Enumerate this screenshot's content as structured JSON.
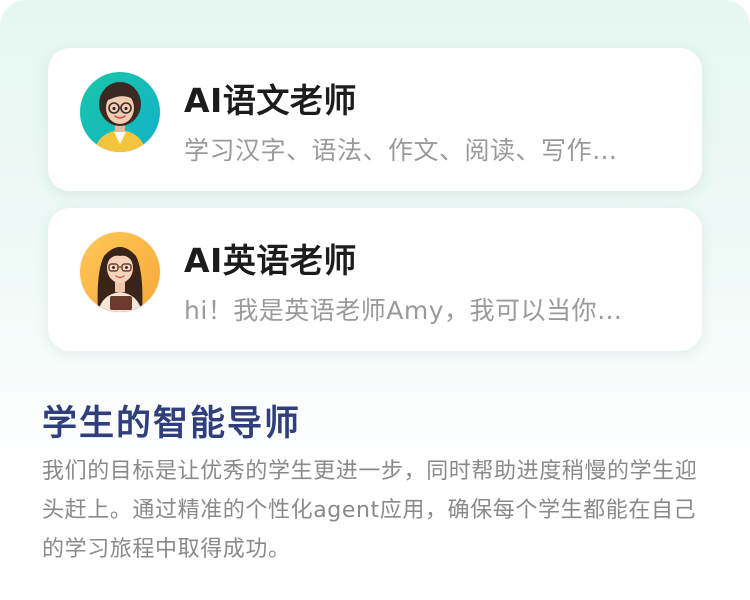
{
  "teachers": [
    {
      "title": "AI语文老师",
      "description": "学习汉字、语法、作文、阅读、写作…",
      "avatar_icon": "teacher-avatar-chinese"
    },
    {
      "title": "AI英语老师",
      "description": "hi！我是英语老师Amy，我可以当你…",
      "avatar_icon": "teacher-avatar-english"
    }
  ],
  "section": {
    "title": "学生的智能导师",
    "body": "我们的目标是让优秀的学生更进一步，同时帮助进度稍慢的学生迎头赶上。通过精准的个性化agent应用，确保每个学生都能在自己的学习旅程中取得成功。"
  },
  "colors": {
    "section_title": "#2e3f7c",
    "card_title": "#1c1c1c",
    "muted_text": "#9a9a9a",
    "background_top": "#e6f7f1"
  }
}
